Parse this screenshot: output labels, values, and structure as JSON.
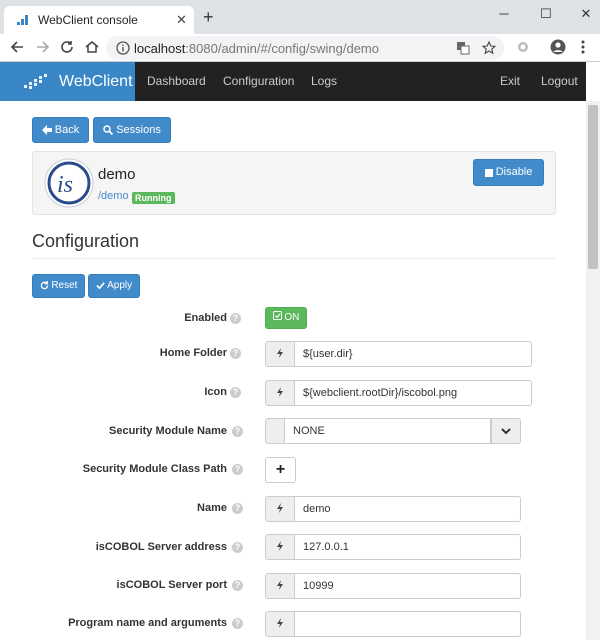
{
  "browser": {
    "tab_title": "WebClient console",
    "url_host": "localhost",
    "url_path": ":8080/admin/#/config/swing/demo"
  },
  "navbar": {
    "brand": "WebClient",
    "links": [
      "Dashboard",
      "Configuration",
      "Logs"
    ],
    "right_links": [
      "Exit",
      "Logout"
    ]
  },
  "toolbar": {
    "back_label": "Back",
    "sessions_label": "Sessions"
  },
  "app": {
    "name": "demo",
    "path": "/demo",
    "status": "Running",
    "disable_label": "Disable",
    "logo_text": "is"
  },
  "config": {
    "title": "Configuration",
    "reset_label": "Reset",
    "apply_label": "Apply",
    "fields": {
      "enabled": {
        "label": "Enabled",
        "value": "ON"
      },
      "home_folder": {
        "label": "Home Folder",
        "value": "${user.dir}"
      },
      "icon": {
        "label": "Icon",
        "value": "${webclient.rootDir}/iscobol.png"
      },
      "security_module_name": {
        "label": "Security Module Name",
        "value": "NONE"
      },
      "security_module_class_path": {
        "label": "Security Module Class Path"
      },
      "name": {
        "label": "Name",
        "value": "demo"
      },
      "server_address": {
        "label": "isCOBOL Server address",
        "value": "127.0.0.1"
      },
      "server_port": {
        "label": "isCOBOL Server port",
        "value": "10999"
      },
      "program": {
        "label": "Program name and arguments",
        "value": ""
      }
    }
  },
  "colors": {
    "primary": "#428bca",
    "success": "#5cb85c",
    "navbar": "#222222",
    "brand": "#3a87c8"
  }
}
